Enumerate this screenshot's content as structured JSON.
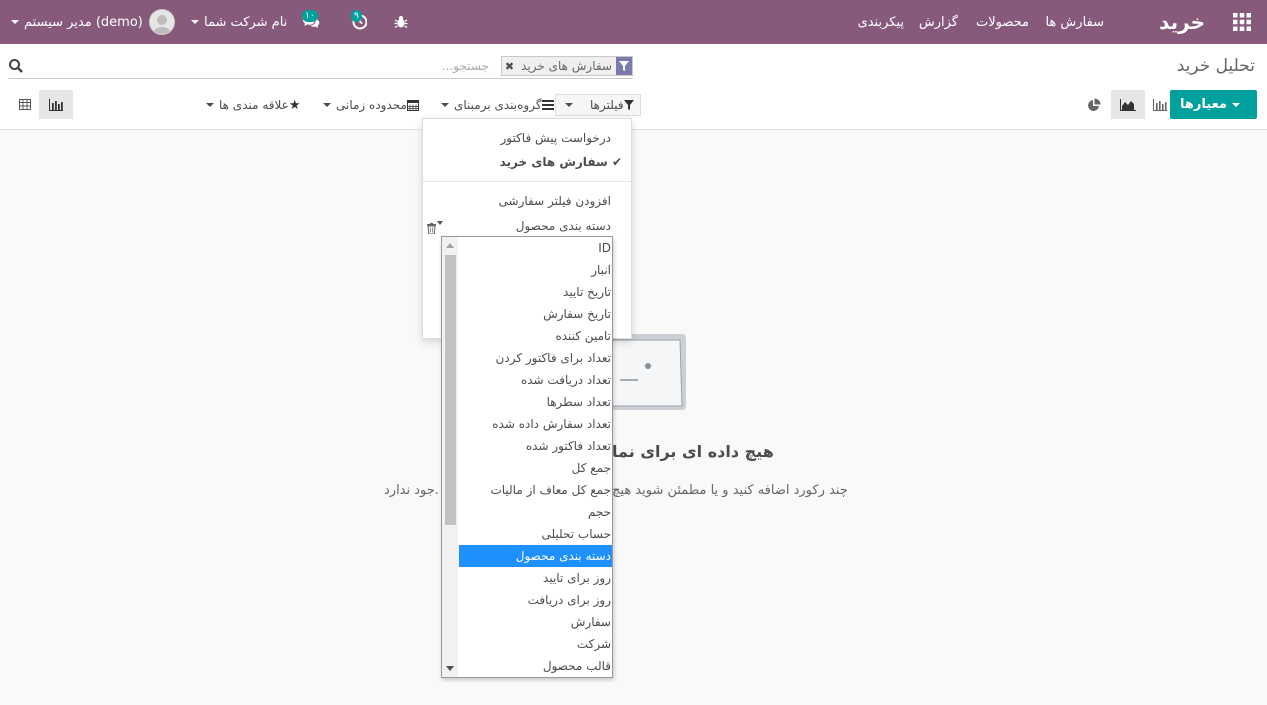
{
  "navbar": {
    "brand": "خرید",
    "menu": [
      "سفارش ها",
      "محصولات",
      "گزارش",
      "پیکربندی"
    ],
    "user": "مدیر سیستم (demo)",
    "company": "نام شرکت شما",
    "messages_count": "۱۰",
    "activity_count": "۹"
  },
  "control_panel": {
    "breadcrumb": "تحلیل خرید",
    "search": {
      "facet": "سفارش های خرید",
      "placeholder": "جستجو..."
    },
    "measures_label": "معیارها",
    "filters_label": "فیلترها",
    "groupby_label": "گروه‌بندی برمبنای",
    "timerange_label": "محدوده زمانی",
    "favorites_label": "علاقه مندی ها"
  },
  "filter_dropdown": {
    "items": [
      "درخواست پیش فاکتور",
      "سفارش های خرید"
    ],
    "add_custom": "افزودن فیلتر سفارشی",
    "custom_field": "دسته بندی محصول"
  },
  "field_options": [
    "ID",
    "انبار",
    "تاریخ تایید",
    "تاریخ سفارش",
    "تامین کننده",
    "تعداد برای فاکتور کردن",
    "تعداد دریافت شده",
    "تعداد سطرها",
    "تعداد سفارش داده شده",
    "تعداد فاکتور شده",
    "جمع کل",
    "جمع کل معاف از مالیات",
    "حجم",
    "حساب تحلیلی",
    "دسته بندی محصول",
    "روز برای تایید",
    "روز برای دریافت",
    "سفارش",
    "شرکت",
    "قالب محصول"
  ],
  "selected_option": "دسته بندی محصول",
  "no_content": {
    "title": "هیچ داده ای برای نما",
    "text_right": "چند رکورد اضافه کنید و یا مطمئن شوید هیچ",
    "text_left": "جود ندارد."
  },
  "colors": {
    "navbar": "#875a7b",
    "primary": "#00a09d",
    "selection": "#1e90ff"
  }
}
